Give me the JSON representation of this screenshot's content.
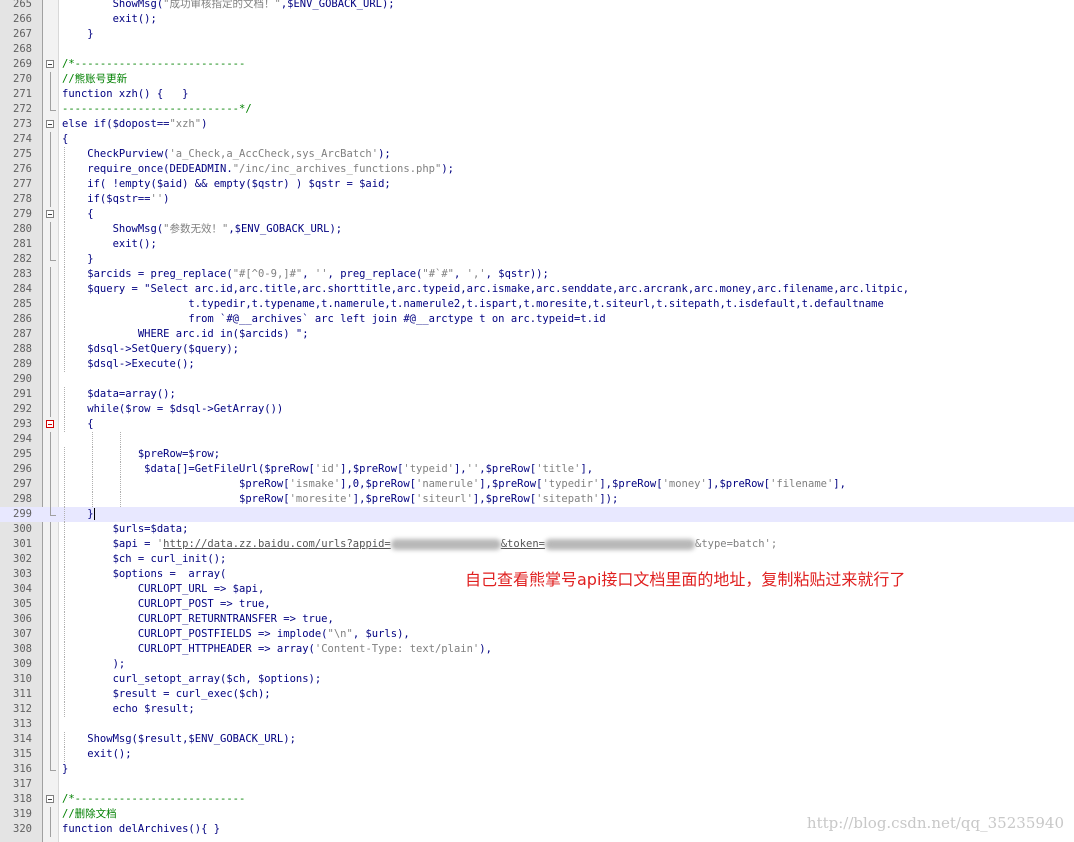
{
  "annotation": "自己查看熊掌号api接口文档里面的地址，复制粘贴过来就行了",
  "watermark": "http://blog.csdn.net/qq_35235940",
  "lines": [
    {
      "n": "265",
      "t": "        ShowMsg(\"成功审核指定的文档！\",$ENV_GOBACK_URL);"
    },
    {
      "n": "266",
      "t": "        exit();"
    },
    {
      "n": "267",
      "t": "    }"
    },
    {
      "n": "268",
      "t": ""
    },
    {
      "n": "269",
      "t": "/*---------------------------"
    },
    {
      "n": "270",
      "t": "//熊账号更新"
    },
    {
      "n": "271",
      "t": "function xzh() {   }"
    },
    {
      "n": "272",
      "t": "----------------------------*/"
    },
    {
      "n": "273",
      "t": "else if($dopost==\"xzh\")"
    },
    {
      "n": "274",
      "t": "{"
    },
    {
      "n": "275",
      "t": "    CheckPurview('a_Check,a_AccCheck,sys_ArcBatch');"
    },
    {
      "n": "276",
      "t": "    require_once(DEDEADMIN.\"/inc/inc_archives_functions.php\");"
    },
    {
      "n": "277",
      "t": "    if( !empty($aid) && empty($qstr) ) $qstr = $aid;"
    },
    {
      "n": "278",
      "t": "    if($qstr=='')"
    },
    {
      "n": "279",
      "t": "    {"
    },
    {
      "n": "280",
      "t": "        ShowMsg(\"参数无效！\",$ENV_GOBACK_URL);"
    },
    {
      "n": "281",
      "t": "        exit();"
    },
    {
      "n": "282",
      "t": "    }"
    },
    {
      "n": "283",
      "t": "    $arcids = preg_replace(\"#[^0-9,]#\", '', preg_replace(\"#`#\", ',', $qstr));"
    },
    {
      "n": "284",
      "t": "    $query = \"Select arc.id,arc.title,arc.shorttitle,arc.typeid,arc.ismake,arc.senddate,arc.arcrank,arc.money,arc.filename,arc.litpic,"
    },
    {
      "n": "285",
      "t": "                    t.typedir,t.typename,t.namerule,t.namerule2,t.ispart,t.moresite,t.siteurl,t.sitepath,t.isdefault,t.defaultname"
    },
    {
      "n": "286",
      "t": "                    from `#@__archives` arc left join #@__arctype t on arc.typeid=t.id"
    },
    {
      "n": "287",
      "t": "            WHERE arc.id in($arcids) \";"
    },
    {
      "n": "288",
      "t": "    $dsql->SetQuery($query);"
    },
    {
      "n": "289",
      "t": "    $dsql->Execute();"
    },
    {
      "n": "290",
      "t": ""
    },
    {
      "n": "291",
      "t": "    $data=array();"
    },
    {
      "n": "292",
      "t": "    while($row = $dsql->GetArray())"
    },
    {
      "n": "293",
      "t": "    {"
    },
    {
      "n": "294",
      "t": ""
    },
    {
      "n": "295",
      "t": "            $preRow=$row;"
    },
    {
      "n": "296",
      "t": "             $data[]=GetFileUrl($preRow['id'],$preRow['typeid'],'',$preRow['title'],"
    },
    {
      "n": "297",
      "t": "                            $preRow['ismake'],0,$preRow['namerule'],$preRow['typedir'],$preRow['money'],$preRow['filename'],"
    },
    {
      "n": "298",
      "t": "                            $preRow['moresite'],$preRow['siteurl'],$preRow['sitepath']);"
    },
    {
      "n": "299",
      "t": "    }"
    },
    {
      "n": "300",
      "t": "        $urls=$data;"
    },
    {
      "n": "301",
      "t": "        $api = 'http://data.zz.baidu.com/urls?appid="
    },
    {
      "n": "302",
      "t": "        $ch = curl_init();"
    },
    {
      "n": "303",
      "t": "        $options =  array("
    },
    {
      "n": "304",
      "t": "            CURLOPT_URL => $api,"
    },
    {
      "n": "305",
      "t": "            CURLOPT_POST => true,"
    },
    {
      "n": "306",
      "t": "            CURLOPT_RETURNTRANSFER => true,"
    },
    {
      "n": "307",
      "t": "            CURLOPT_POSTFIELDS => implode(\"\\n\", $urls),"
    },
    {
      "n": "308",
      "t": "            CURLOPT_HTTPHEADER => array('Content-Type: text/plain'),"
    },
    {
      "n": "309",
      "t": "        );"
    },
    {
      "n": "310",
      "t": "        curl_setopt_array($ch, $options);"
    },
    {
      "n": "311",
      "t": "        $result = curl_exec($ch);"
    },
    {
      "n": "312",
      "t": "        echo $result;"
    },
    {
      "n": "313",
      "t": ""
    },
    {
      "n": "314",
      "t": "    ShowMsg($result,$ENV_GOBACK_URL);"
    },
    {
      "n": "315",
      "t": "    exit();"
    },
    {
      "n": "316",
      "t": "}"
    },
    {
      "n": "317",
      "t": ""
    },
    {
      "n": "318",
      "t": "/*---------------------------"
    },
    {
      "n": "319",
      "t": "//删除文档"
    },
    {
      "n": "320",
      "t": "function delArchives(){ }"
    }
  ],
  "line301_tail": "&token=",
  "line301_end": "&type=batch';",
  "colors": {
    "keyword": "#0000ff",
    "string": "#808080",
    "comment": "#008000",
    "number": "#ff0000",
    "annotation": "#e02020"
  }
}
